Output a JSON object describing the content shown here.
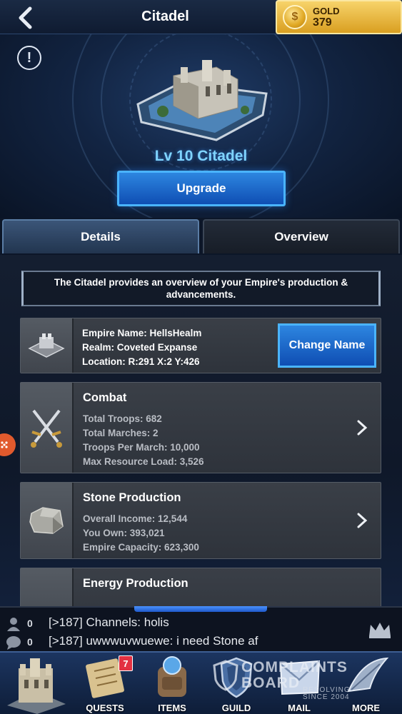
{
  "header": {
    "title": "Citadel",
    "gold_label": "GOLD",
    "gold_value": "379"
  },
  "hero": {
    "level_title": "Lv 10 Citadel",
    "upgrade_label": "Upgrade"
  },
  "tabs": [
    {
      "label": "Details",
      "active": true
    },
    {
      "label": "Overview",
      "active": false
    }
  ],
  "description": "The Citadel provides an overview of your Empire's production & advancements.",
  "empire_card": {
    "name_line": "Empire Name: HellsHealm",
    "realm_line": "Realm: Coveted Expanse",
    "location_line": "Location: R:291 X:2 Y:426",
    "change_name_label": "Change Name"
  },
  "cards": [
    {
      "title": "Combat",
      "lines": [
        "Total Troops: 682",
        "Total Marches: 2",
        "Troops Per March: 10,000",
        "Max Resource Load: 3,526"
      ]
    },
    {
      "title": "Stone Production",
      "lines": [
        "Overall Income: 12,544",
        "You Own: 393,021",
        "Empire Capacity: 623,300"
      ]
    },
    {
      "title": "Energy Production",
      "lines": []
    }
  ],
  "chat": {
    "rows": [
      {
        "icon": "person-icon",
        "count": "0",
        "message": "[>187] Channels: holis"
      },
      {
        "icon": "chat-bubble-icon",
        "count": "0",
        "message": "[>187] uwwwuvwuewe: i need Stone af"
      }
    ]
  },
  "bottom_nav": [
    {
      "label": "",
      "icon": "citadel-icon"
    },
    {
      "label": "QUESTS",
      "icon": "scroll-icon",
      "badge": "7"
    },
    {
      "label": "ITEMS",
      "icon": "backpack-icon"
    },
    {
      "label": "GUILD",
      "icon": "shield-icon"
    },
    {
      "label": "MAIL",
      "icon": "mail-icon"
    },
    {
      "label": "MORE",
      "icon": "more-icon"
    }
  ],
  "watermark": {
    "main_line1": "COMPLAINTS",
    "main_line2": "BOARD",
    "sub_line1": "RESOLVING",
    "sub_line2": "SINCE 2004"
  },
  "colors": {
    "accent_blue": "#2d86e0",
    "gold": "#d99f21",
    "level_title": "#7fd4ff",
    "badge_red": "#e33142"
  }
}
